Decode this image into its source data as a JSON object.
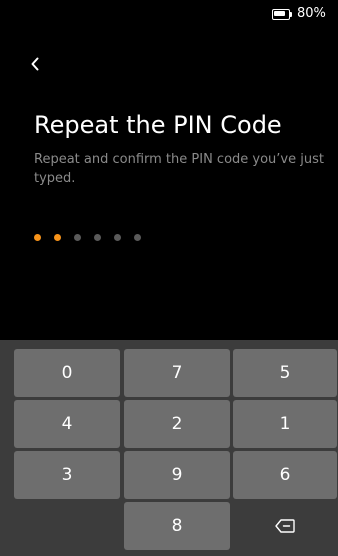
{
  "status_bar": {
    "battery_text": "80%",
    "battery_level": 0.8,
    "battery_icon": "battery-icon"
  },
  "header": {
    "back_icon": "chevron-left-icon"
  },
  "content": {
    "title": "Repeat the PIN Code",
    "subtitle": "Repeat and confirm the PIN code you’ve just typed."
  },
  "pin": {
    "length": 6,
    "entered": 2,
    "filled_color": "#f7931a",
    "empty_color": "#5a5a5a"
  },
  "keypad": {
    "keys": [
      "0",
      "7",
      "5",
      "4",
      "2",
      "1",
      "3",
      "9",
      "6",
      "",
      "8",
      "backspace"
    ],
    "backspace_icon": "backspace-icon"
  },
  "colors": {
    "background": "#000000",
    "text_primary": "#ffffff",
    "text_secondary": "#8a8a8a",
    "accent": "#f7931a",
    "keypad_background": "#3c3c3c",
    "key_background": "#6e6e6e"
  }
}
